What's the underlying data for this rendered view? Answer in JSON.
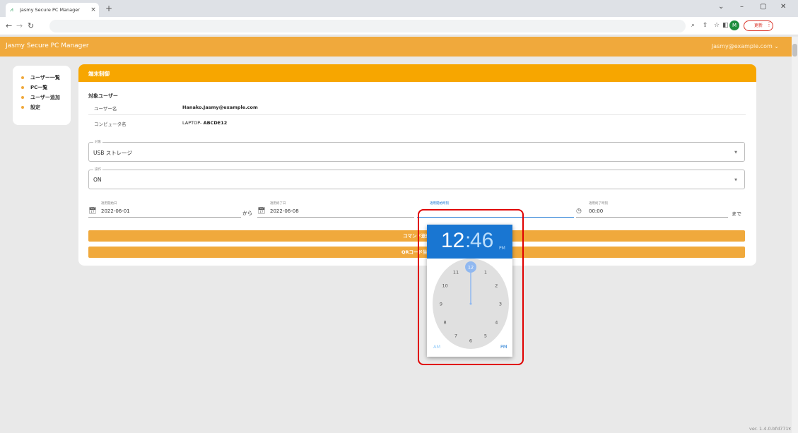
{
  "browser": {
    "tab_title": "Jasmy Secure PC Manager",
    "update_label": "更新"
  },
  "app": {
    "title": "Jasmy Secure PC Manager",
    "user": "Jasmy@example.com ⌄"
  },
  "sidebar": {
    "items": [
      {
        "label": "ユーザー一覧"
      },
      {
        "label": "PC一覧"
      },
      {
        "label": "ユーザー追加"
      },
      {
        "label": "設定"
      }
    ]
  },
  "card": {
    "header": "端末制御",
    "section_label": "対象ユーザー",
    "rows": [
      {
        "key": "ユーザー名",
        "value": "Hanako.Jasmy@example.com"
      },
      {
        "key": "コンピュータ名",
        "value_prefix": "LAPTOP-",
        "value": "ABCDE12"
      }
    ],
    "target": {
      "legend": "対象",
      "value": "USB ストレージ"
    },
    "operation": {
      "legend": "操作",
      "value": "ON"
    },
    "dates": {
      "start_date_label": "適用開始日",
      "start_date": "2022-06-01",
      "kara": "から",
      "end_date_label": "適用終了日",
      "end_date": "2022-06-08",
      "start_time_label": "適用開始時刻",
      "start_time": "12:46",
      "end_time_label": "適用終了時刻",
      "end_time": "00:00",
      "made": "まで"
    },
    "buttons": {
      "command": "コマンド送信",
      "qr": "QRコード生成"
    }
  },
  "time_picker": {
    "hour": "12",
    "colon": ":",
    "minute": "46",
    "ampm": "PM",
    "am_label": "AM",
    "pm_label": "PM",
    "selected_hour": 12,
    "hours": [
      "12",
      "1",
      "2",
      "3",
      "4",
      "5",
      "6",
      "7",
      "8",
      "9",
      "10",
      "11"
    ]
  },
  "footer": {
    "version": "ver. 1.4.0.bfd771c"
  },
  "colors": {
    "accent": "#f0a93c",
    "header_orange": "#f7a600",
    "picker_blue": "#1976d2",
    "highlight_red": "#e00000"
  }
}
